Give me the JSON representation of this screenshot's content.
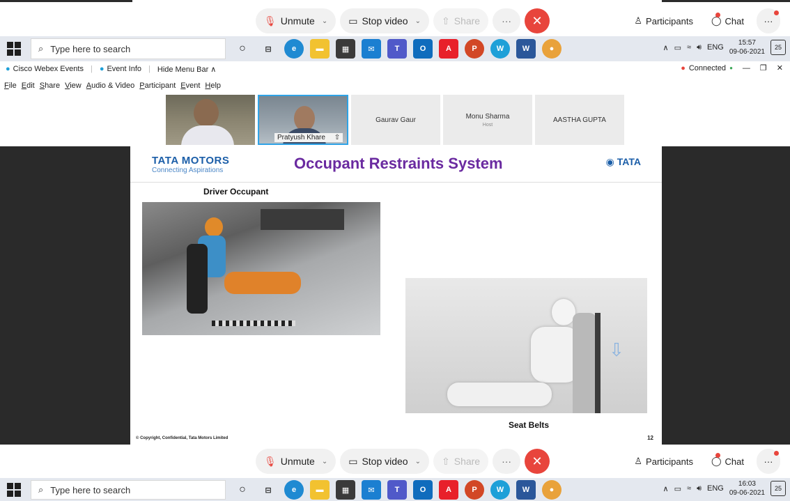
{
  "meeting_controls_top": {
    "unmute": "Unmute",
    "stop_video": "Stop video",
    "share": "Share",
    "more": "···",
    "end": "✕",
    "participants": "Participants",
    "chat": "Chat",
    "more_right": "···"
  },
  "meeting_controls_bottom": {
    "unmute": "Unmute",
    "stop_video": "Stop video",
    "share": "Share",
    "more": "···",
    "end": "✕",
    "participants": "Participants",
    "chat": "Chat",
    "more_right": "···"
  },
  "taskbar_top": {
    "search_placeholder": "Type here to search",
    "lang": "ENG",
    "time": "15:57",
    "date": "09-06-2021",
    "notifications": "25"
  },
  "taskbar_bottom": {
    "search_placeholder": "Type here to search",
    "lang": "ENG",
    "time": "16:03",
    "date": "09-06-2021",
    "notifications": "25"
  },
  "webex": {
    "app_name": "Cisco Webex Events",
    "event_info": "Event Info",
    "hide_menu": "Hide Menu Bar ∧",
    "status": "Connected",
    "menu": [
      "File",
      "Edit",
      "Share",
      "View",
      "Audio & Video",
      "Participant",
      "Event",
      "Help"
    ]
  },
  "participants": [
    {
      "name": "",
      "role": "",
      "video": true
    },
    {
      "name": "Pratyush Khare",
      "role": "",
      "video": true
    },
    {
      "name": "Gaurav Gaur",
      "role": "",
      "video": false
    },
    {
      "name": "Monu Sharma",
      "role": "Host",
      "video": false
    },
    {
      "name": "AASTHA GUPTA",
      "role": "",
      "video": false
    }
  ],
  "slide": {
    "brand_name": "TATA MOTORS",
    "brand_tagline": "Connecting Aspirations",
    "title": "Occupant Restraints System",
    "logo_right": "TATA",
    "caption_driver": "Driver Occupant",
    "caption_seat": "Seat Belts",
    "copyright": "© Copyright, Confidential, Tata Motors Limited",
    "page_number": "12"
  },
  "colors": {
    "end_call": "#e8453c",
    "slide_title": "#6a2aa0",
    "brand_blue": "#1b5ea8",
    "active_speaker_border": "#2fa3e6",
    "connected": "#e8453c"
  }
}
